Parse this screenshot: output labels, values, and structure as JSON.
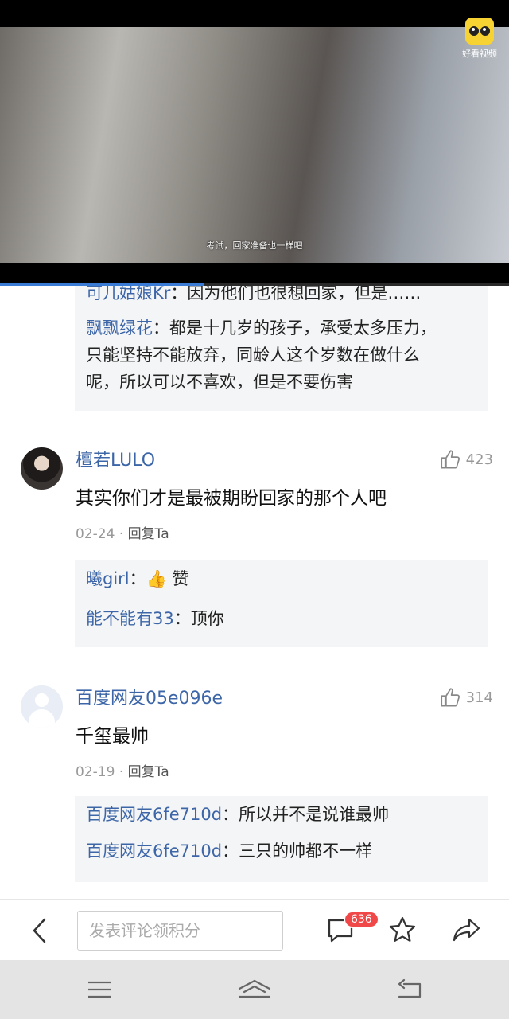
{
  "video": {
    "subtitle": "考试，回家准备也一样吧",
    "logo_text": "好看视频",
    "progress_fraction": 0.4
  },
  "replies_top": [
    {
      "name": "可儿姑娘Kr",
      "text": "：因为他们也很想回家，但是……"
    },
    {
      "name": "飘飘绿花",
      "text": "：都是十几岁的孩子，承受太多压力，"
    },
    {
      "name": "",
      "text": "只能坚持不能放弃，同龄人这个岁数在做什么"
    },
    {
      "name": "",
      "text": "呢，所以可以不喜欢，但是不要伤害"
    }
  ],
  "comments": [
    {
      "name": "檀若LULO",
      "likes": "423",
      "text": "其实你们才是最被期盼回家的那个人吧",
      "date": "02-24",
      "separator": "·",
      "reply_label": "回复Ta",
      "replies": [
        {
          "name": "曦girl",
          "text": "：👍 赞"
        },
        {
          "name": "能不能有33",
          "text": "：顶你"
        }
      ]
    },
    {
      "name": "百度网友05e096e",
      "likes": "314",
      "text": "千玺最帅",
      "date": "02-19",
      "separator": "·",
      "reply_label": "回复Ta",
      "replies": [
        {
          "name": "百度网友6fe710d",
          "text": "：所以并不是说谁最帅"
        },
        {
          "name": "百度网友6fe710d",
          "text": "：三只的帅都不一样"
        }
      ]
    }
  ],
  "action_bar": {
    "input_placeholder": "发表评论领积分",
    "comment_count": "636"
  },
  "colors": {
    "username": "#3d66a8",
    "badge": "#f04848",
    "progress": "#3a7bd5"
  },
  "icons": [
    "back-icon",
    "comment-icon",
    "star-icon",
    "share-icon",
    "thumbs-up-icon",
    "menu-icon",
    "home-icon",
    "return-icon"
  ]
}
